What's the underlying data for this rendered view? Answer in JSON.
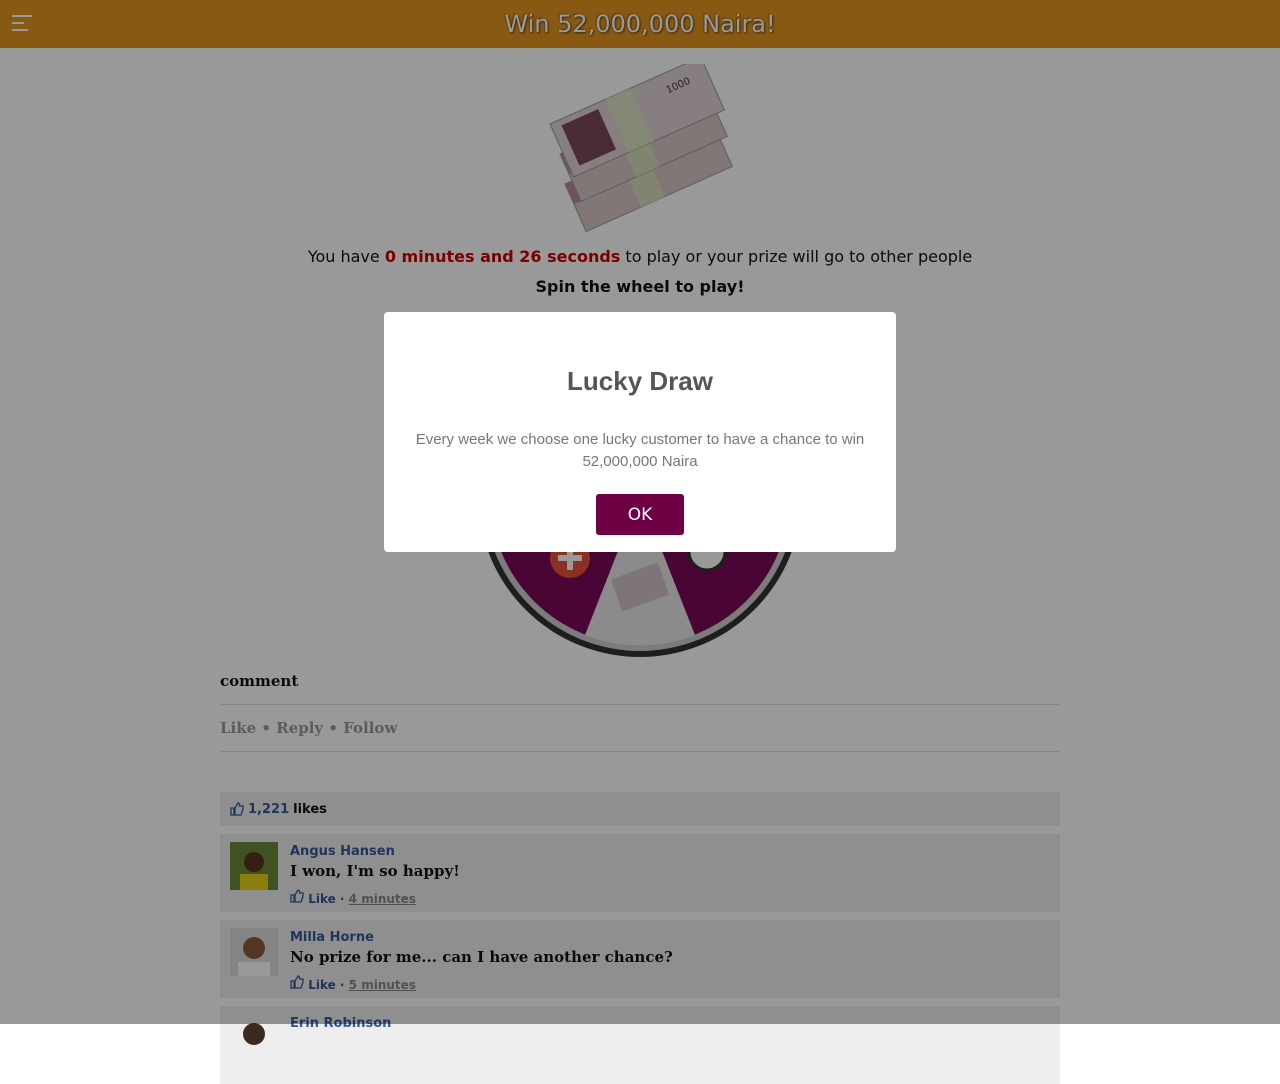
{
  "header": {
    "title": "Win 52,000,000 Naira!",
    "menu_icon": "hamburger-icon"
  },
  "timer": {
    "prefix": "You have",
    "countdown": "0 minutes and 26 seconds",
    "suffix": "to play or your prize will go to other people"
  },
  "cta": {
    "text": "Spin the wheel to play!"
  },
  "comments": {
    "heading": "comment",
    "actions": [
      "Like",
      "Reply",
      "Follow"
    ],
    "likes": {
      "count": "1,221",
      "label": "likes"
    },
    "items": [
      {
        "name": "Angus Hansen",
        "text": "I won, I'm so happy!",
        "like": "Like",
        "time": "4 minutes"
      },
      {
        "name": "Milla Horne",
        "text": "No prize for me... can I have another chance?",
        "like": "Like",
        "time": "5 minutes"
      },
      {
        "name": "Erin Robinson",
        "text": "",
        "like": "",
        "time": ""
      }
    ]
  },
  "modal": {
    "title": "Lucky Draw",
    "body": "Every week we choose one lucky customer to have a chance to win 52,000,000 Naira",
    "ok_label": "OK"
  },
  "colors": {
    "header": "#e3951e",
    "accent": "#6e0044",
    "countdown": "#cc0000",
    "link": "#365899"
  }
}
